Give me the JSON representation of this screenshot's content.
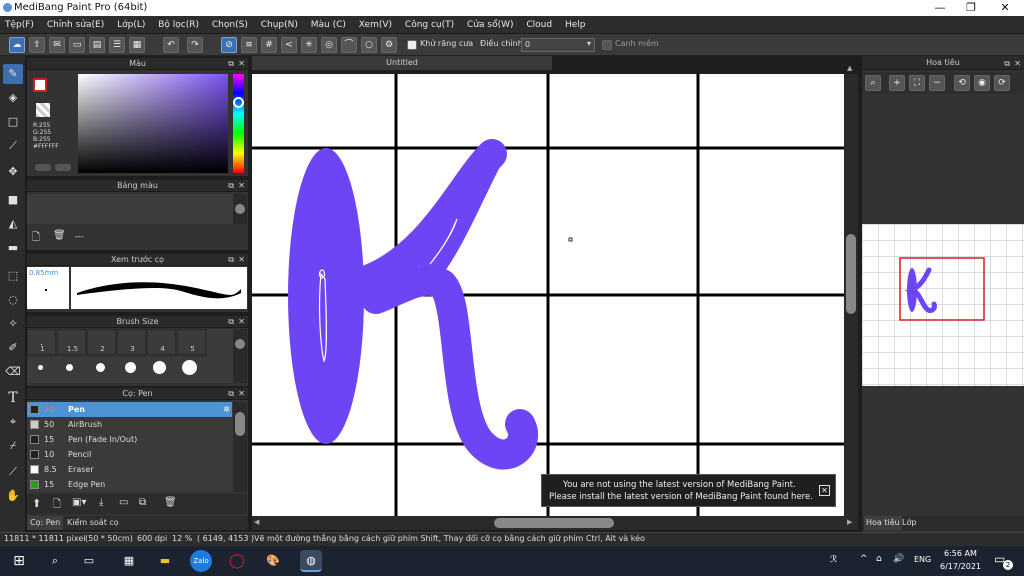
{
  "app": {
    "title": "MediBang Paint Pro (64bit)"
  },
  "window_controls": {
    "minimize": "—",
    "maximize": "❐",
    "close": "✕"
  },
  "menu": [
    "Tệp(F)",
    "Chỉnh sửa(E)",
    "Lớp(L)",
    "Bộ lọc(R)",
    "Chọn(S)",
    "Chụp(N)",
    "Màu (C)",
    "Xem(V)",
    "Công cụ(T)",
    "Cửa sổ(W)",
    "Cloud",
    "Help"
  ],
  "toolbar": {
    "antialias_label": "Khử răng cưa",
    "correction_label": "Điều chỉnh",
    "correction_value": "0",
    "edge_label": "Canh mềm"
  },
  "color_panel": {
    "title": "Màu",
    "r": "R:255",
    "g": "G:255",
    "b": "B:255",
    "hex": "#FFFFFF",
    "primary_color": "#ffffff",
    "hue_accent": "#7b52f0"
  },
  "palette_panel": {
    "title": "Bảng màu",
    "value": "---"
  },
  "brush_preview_panel": {
    "title": "Xem trước cọ",
    "size": "0.85mm"
  },
  "brush_size_panel": {
    "title": "Brush Size",
    "sizes": [
      "1",
      "1.5",
      "2",
      "3",
      "4",
      "5"
    ]
  },
  "brush_panel": {
    "title": "Cọ: Pen",
    "items": [
      {
        "size": "20",
        "name": "Pen",
        "color": "#222222"
      },
      {
        "size": "50",
        "name": "AirBrush",
        "color": "#cccccc"
      },
      {
        "size": "15",
        "name": "Pen (Fade In/Out)",
        "color": "#222222"
      },
      {
        "size": "10",
        "name": "Pencil",
        "color": "#222222"
      },
      {
        "size": "8.5",
        "name": "Eraser",
        "color": "#ffffff"
      },
      {
        "size": "15",
        "name": "Edge Pen",
        "color": "#1aa31a"
      }
    ]
  },
  "bottom_tabs": {
    "brush_tab": "Cọ: Pen",
    "control_tab": "Kiểm soát cọ"
  },
  "document": {
    "tab_title": "Untitled",
    "stroke_color": "#6d45f5"
  },
  "navigator": {
    "title": "Hoa tiêu",
    "tab_navigator": "Hoa tiêu",
    "tab_layers": "Lớp"
  },
  "notification": {
    "line1": "You are not using the latest version of MediBang Paint.",
    "line2": "Please install the latest version of MediBang Paint found here."
  },
  "status": {
    "size": "11811 * 11811 pixel",
    "dims": "(50 * 50cm)",
    "dpi": "600 dpi",
    "zoom": "12 %",
    "coords": "( 6149, 4153 )",
    "hint": "Vẽ một đường thẳng bằng cách giữ phím Shift, Thay đổi cỡ cọ bằng cách giữ phím Ctrl, Alt và kéo"
  },
  "taskbar": {
    "lang": "ENG",
    "time": "6:56 AM",
    "date": "6/17/2021",
    "notif_count": "2"
  }
}
